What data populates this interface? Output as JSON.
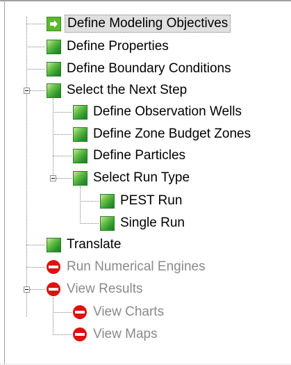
{
  "tree": {
    "items": [
      {
        "label": "Define Modeling Objectives",
        "icon": "arrow-right-icon",
        "state": "selected"
      },
      {
        "label": "Define Properties",
        "icon": "green-square-icon",
        "state": "enabled"
      },
      {
        "label": "Define Boundary Conditions",
        "icon": "green-square-icon",
        "state": "enabled"
      },
      {
        "label": "Select the Next Step",
        "icon": "green-square-icon",
        "state": "enabled",
        "expanded": true,
        "children": [
          {
            "label": "Define Observation Wells",
            "icon": "green-square-icon",
            "state": "enabled"
          },
          {
            "label": "Define Zone Budget Zones",
            "icon": "green-square-icon",
            "state": "enabled"
          },
          {
            "label": "Define Particles",
            "icon": "green-square-icon",
            "state": "enabled"
          },
          {
            "label": "Select Run Type",
            "icon": "green-square-icon",
            "state": "enabled",
            "expanded": true,
            "children": [
              {
                "label": "PEST Run",
                "icon": "green-square-icon",
                "state": "enabled"
              },
              {
                "label": "Single Run",
                "icon": "green-square-icon",
                "state": "enabled"
              }
            ]
          }
        ]
      },
      {
        "label": "Translate",
        "icon": "green-square-icon",
        "state": "enabled"
      },
      {
        "label": "Run Numerical Engines",
        "icon": "no-entry-icon",
        "state": "disabled"
      },
      {
        "label": "View Results",
        "icon": "no-entry-icon",
        "state": "disabled",
        "expanded": true,
        "children": [
          {
            "label": "View Charts",
            "icon": "no-entry-icon",
            "state": "disabled"
          },
          {
            "label": "View Maps",
            "icon": "no-entry-icon",
            "state": "disabled"
          }
        ]
      }
    ]
  },
  "colors": {
    "disabled_text": "#8a8a8a",
    "selected_bg": "#e0e0e0",
    "no_entry_red": "#e01010",
    "green": "#3aa83a"
  }
}
